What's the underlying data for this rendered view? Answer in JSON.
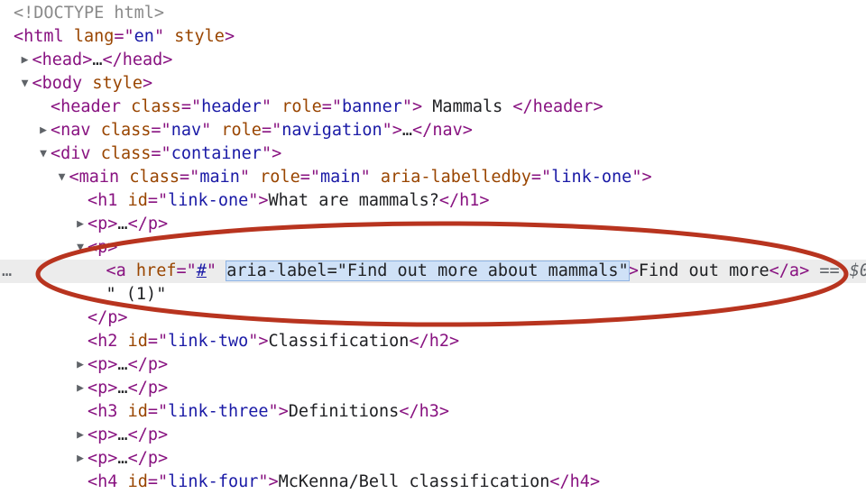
{
  "lines": [
    {
      "id": "doctype",
      "depth": 0,
      "tri": "",
      "parts": [
        {
          "c": "dim",
          "t": "<!DOCTYPE html>"
        }
      ]
    },
    {
      "id": "html",
      "depth": 0,
      "tri": "",
      "parts": [
        {
          "c": "tag",
          "t": "<html "
        },
        {
          "c": "attr",
          "t": "lang"
        },
        {
          "c": "tag",
          "t": "=\""
        },
        {
          "c": "val",
          "t": "en"
        },
        {
          "c": "tag",
          "t": "\" "
        },
        {
          "c": "attr",
          "t": "style"
        },
        {
          "c": "tag",
          "t": ">"
        }
      ]
    },
    {
      "id": "head",
      "depth": 1,
      "tri": "closed",
      "parts": [
        {
          "c": "tag",
          "t": "<head>"
        },
        {
          "c": "",
          "t": "…"
        },
        {
          "c": "tag",
          "t": "</head>"
        }
      ]
    },
    {
      "id": "body",
      "depth": 1,
      "tri": "open",
      "parts": [
        {
          "c": "tag",
          "t": "<body "
        },
        {
          "c": "attr",
          "t": "style"
        },
        {
          "c": "tag",
          "t": ">"
        }
      ]
    },
    {
      "id": "header",
      "depth": 2,
      "tri": "",
      "parts": [
        {
          "c": "tag",
          "t": "<header "
        },
        {
          "c": "attr",
          "t": "class"
        },
        {
          "c": "tag",
          "t": "=\""
        },
        {
          "c": "val",
          "t": "header"
        },
        {
          "c": "tag",
          "t": "\" "
        },
        {
          "c": "attr",
          "t": "role"
        },
        {
          "c": "tag",
          "t": "=\""
        },
        {
          "c": "val",
          "t": "banner"
        },
        {
          "c": "tag",
          "t": "\">"
        },
        {
          "c": "",
          "t": " Mammals "
        },
        {
          "c": "tag",
          "t": "</header>"
        }
      ]
    },
    {
      "id": "nav",
      "depth": 2,
      "tri": "closed",
      "parts": [
        {
          "c": "tag",
          "t": "<nav "
        },
        {
          "c": "attr",
          "t": "class"
        },
        {
          "c": "tag",
          "t": "=\""
        },
        {
          "c": "val",
          "t": "nav"
        },
        {
          "c": "tag",
          "t": "\" "
        },
        {
          "c": "attr",
          "t": "role"
        },
        {
          "c": "tag",
          "t": "=\""
        },
        {
          "c": "val",
          "t": "navigation"
        },
        {
          "c": "tag",
          "t": "\">"
        },
        {
          "c": "",
          "t": "…"
        },
        {
          "c": "tag",
          "t": "</nav>"
        }
      ]
    },
    {
      "id": "div-container",
      "depth": 2,
      "tri": "open",
      "parts": [
        {
          "c": "tag",
          "t": "<div "
        },
        {
          "c": "attr",
          "t": "class"
        },
        {
          "c": "tag",
          "t": "=\""
        },
        {
          "c": "val",
          "t": "container"
        },
        {
          "c": "tag",
          "t": "\">"
        }
      ]
    },
    {
      "id": "main",
      "depth": 3,
      "tri": "open",
      "parts": [
        {
          "c": "tag",
          "t": "<main "
        },
        {
          "c": "attr",
          "t": "class"
        },
        {
          "c": "tag",
          "t": "=\""
        },
        {
          "c": "val",
          "t": "main"
        },
        {
          "c": "tag",
          "t": "\" "
        },
        {
          "c": "attr",
          "t": "role"
        },
        {
          "c": "tag",
          "t": "=\""
        },
        {
          "c": "val",
          "t": "main"
        },
        {
          "c": "tag",
          "t": "\" "
        },
        {
          "c": "attr",
          "t": "aria-labelledby"
        },
        {
          "c": "tag",
          "t": "=\""
        },
        {
          "c": "val",
          "t": "link-one"
        },
        {
          "c": "tag",
          "t": "\">"
        }
      ]
    },
    {
      "id": "h1",
      "depth": 4,
      "tri": "",
      "parts": [
        {
          "c": "tag",
          "t": "<h1 "
        },
        {
          "c": "attr",
          "t": "id"
        },
        {
          "c": "tag",
          "t": "=\""
        },
        {
          "c": "val",
          "t": "link-one"
        },
        {
          "c": "tag",
          "t": "\">"
        },
        {
          "c": "",
          "t": "What are mammals?"
        },
        {
          "c": "tag",
          "t": "</h1>"
        }
      ]
    },
    {
      "id": "p1",
      "depth": 4,
      "tri": "closed",
      "parts": [
        {
          "c": "tag",
          "t": "<p>"
        },
        {
          "c": "",
          "t": "…"
        },
        {
          "c": "tag",
          "t": "</p>"
        }
      ]
    },
    {
      "id": "p2-open",
      "depth": 4,
      "tri": "open",
      "parts": [
        {
          "c": "tag",
          "t": "<p>"
        }
      ]
    },
    {
      "id": "anchor",
      "depth": 5,
      "tri": "",
      "selected": true,
      "gutter": "…",
      "parts": [
        {
          "c": "tag",
          "t": "<a "
        },
        {
          "c": "attr",
          "t": "href"
        },
        {
          "c": "tag",
          "t": "=\""
        },
        {
          "c": "link",
          "t": "#"
        },
        {
          "c": "tag",
          "t": "\" "
        },
        {
          "c": "hl",
          "t": "aria-label=\"Find out more about mammals\""
        },
        {
          "c": "tag",
          "t": ">"
        },
        {
          "c": "",
          "t": "Find out more"
        },
        {
          "c": "tag",
          "t": "</a>"
        },
        {
          "c": "eq",
          "t": " == $0"
        }
      ]
    },
    {
      "id": "text-node",
      "depth": 5,
      "tri": "",
      "parts": [
        {
          "c": "",
          "t": "\" (1)\""
        }
      ]
    },
    {
      "id": "p2-close",
      "depth": 4,
      "tri": "",
      "parts": [
        {
          "c": "tag",
          "t": "</p>"
        }
      ]
    },
    {
      "id": "h2",
      "depth": 4,
      "tri": "",
      "parts": [
        {
          "c": "tag",
          "t": "<h2 "
        },
        {
          "c": "attr",
          "t": "id"
        },
        {
          "c": "tag",
          "t": "=\""
        },
        {
          "c": "val",
          "t": "link-two"
        },
        {
          "c": "tag",
          "t": "\">"
        },
        {
          "c": "",
          "t": "Classification"
        },
        {
          "c": "tag",
          "t": "</h2>"
        }
      ]
    },
    {
      "id": "p3",
      "depth": 4,
      "tri": "closed",
      "parts": [
        {
          "c": "tag",
          "t": "<p>"
        },
        {
          "c": "",
          "t": "…"
        },
        {
          "c": "tag",
          "t": "</p>"
        }
      ]
    },
    {
      "id": "p4",
      "depth": 4,
      "tri": "closed",
      "parts": [
        {
          "c": "tag",
          "t": "<p>"
        },
        {
          "c": "",
          "t": "…"
        },
        {
          "c": "tag",
          "t": "</p>"
        }
      ]
    },
    {
      "id": "h3",
      "depth": 4,
      "tri": "",
      "parts": [
        {
          "c": "tag",
          "t": "<h3 "
        },
        {
          "c": "attr",
          "t": "id"
        },
        {
          "c": "tag",
          "t": "=\""
        },
        {
          "c": "val",
          "t": "link-three"
        },
        {
          "c": "tag",
          "t": "\">"
        },
        {
          "c": "",
          "t": "Definitions"
        },
        {
          "c": "tag",
          "t": "</h3>"
        }
      ]
    },
    {
      "id": "p5",
      "depth": 4,
      "tri": "closed",
      "parts": [
        {
          "c": "tag",
          "t": "<p>"
        },
        {
          "c": "",
          "t": "…"
        },
        {
          "c": "tag",
          "t": "</p>"
        }
      ]
    },
    {
      "id": "p6",
      "depth": 4,
      "tri": "closed",
      "parts": [
        {
          "c": "tag",
          "t": "<p>"
        },
        {
          "c": "",
          "t": "…"
        },
        {
          "c": "tag",
          "t": "</p>"
        }
      ]
    },
    {
      "id": "h4",
      "depth": 4,
      "tri": "",
      "parts": [
        {
          "c": "tag",
          "t": "<h4 "
        },
        {
          "c": "attr",
          "t": "id"
        },
        {
          "c": "tag",
          "t": "=\""
        },
        {
          "c": "val",
          "t": "link-four"
        },
        {
          "c": "tag",
          "t": "\">"
        },
        {
          "c": "",
          "t": "McKenna/Bell classification"
        },
        {
          "c": "tag",
          "t": "</h4>"
        }
      ]
    }
  ],
  "icons": {
    "closed": "triangle-right-icon",
    "open": "triangle-down-icon"
  },
  "colors": {
    "annotation": "#b8341f",
    "selection_row": "#ececec",
    "highlight": "#cfe1f7"
  }
}
